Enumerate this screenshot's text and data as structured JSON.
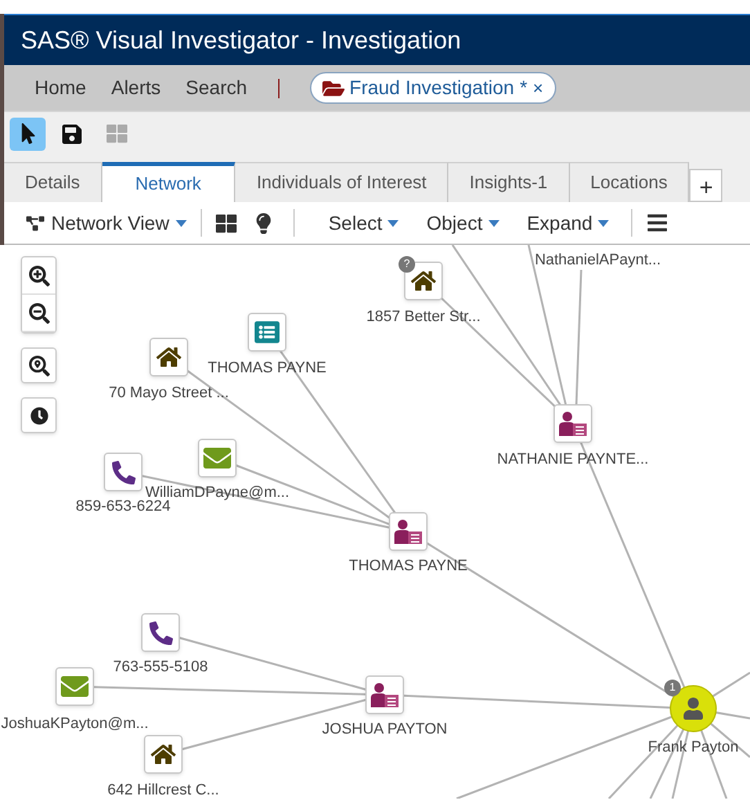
{
  "window": {
    "title": "SAS® Visual Investigator - Investigation"
  },
  "nav": {
    "items": [
      "Home",
      "Alerts",
      "Search"
    ],
    "open_tab": {
      "label": "Fraud Investigation",
      "unsaved_mark": "*",
      "close": "×"
    }
  },
  "tools": [
    {
      "kind": "select",
      "selected": true,
      "disabled": false
    },
    {
      "kind": "save",
      "selected": false,
      "disabled": false
    },
    {
      "kind": "layout",
      "selected": false,
      "disabled": true
    }
  ],
  "tabs": [
    {
      "label": "Details",
      "selected": false
    },
    {
      "label": "Network",
      "selected": true
    },
    {
      "label": "Individuals of Interest",
      "selected": false
    },
    {
      "label": "Insights-1",
      "selected": false
    },
    {
      "label": "Locations",
      "selected": false
    }
  ],
  "add_tab": "+",
  "network_toolbar": {
    "view_menu": "Network View",
    "menus": [
      "Select",
      "Object",
      "Expand"
    ]
  },
  "zoom_controls": [
    {
      "kind": "zoom-in"
    },
    {
      "kind": "zoom-out"
    },
    {
      "kind": "fit"
    },
    {
      "kind": "timeline"
    }
  ],
  "nodes": [
    {
      "kind": "house",
      "label": "1857 Better Str...",
      "badge": "?"
    },
    {
      "kind": "label-only",
      "label": "NathanielAPaynt..."
    },
    {
      "kind": "person",
      "label": "NATHANIE PAYNTE..."
    },
    {
      "kind": "document",
      "label": "THOMAS PAYNE"
    },
    {
      "kind": "house",
      "label": "70 Mayo Street ..."
    },
    {
      "kind": "email",
      "label": "WilliamDPayne@m..."
    },
    {
      "kind": "phone",
      "label": "859-653-6224"
    },
    {
      "kind": "person",
      "label": "THOMAS PAYNE"
    },
    {
      "kind": "phone",
      "label": "763-555-5108"
    },
    {
      "kind": "email",
      "label": "JoshuaKPayton@m..."
    },
    {
      "kind": "person",
      "label": "JOSHUA PAYTON"
    },
    {
      "kind": "house",
      "label": "642 Hillcrest C..."
    },
    {
      "kind": "focus",
      "label": "Frank Payton",
      "badge": "1"
    }
  ]
}
